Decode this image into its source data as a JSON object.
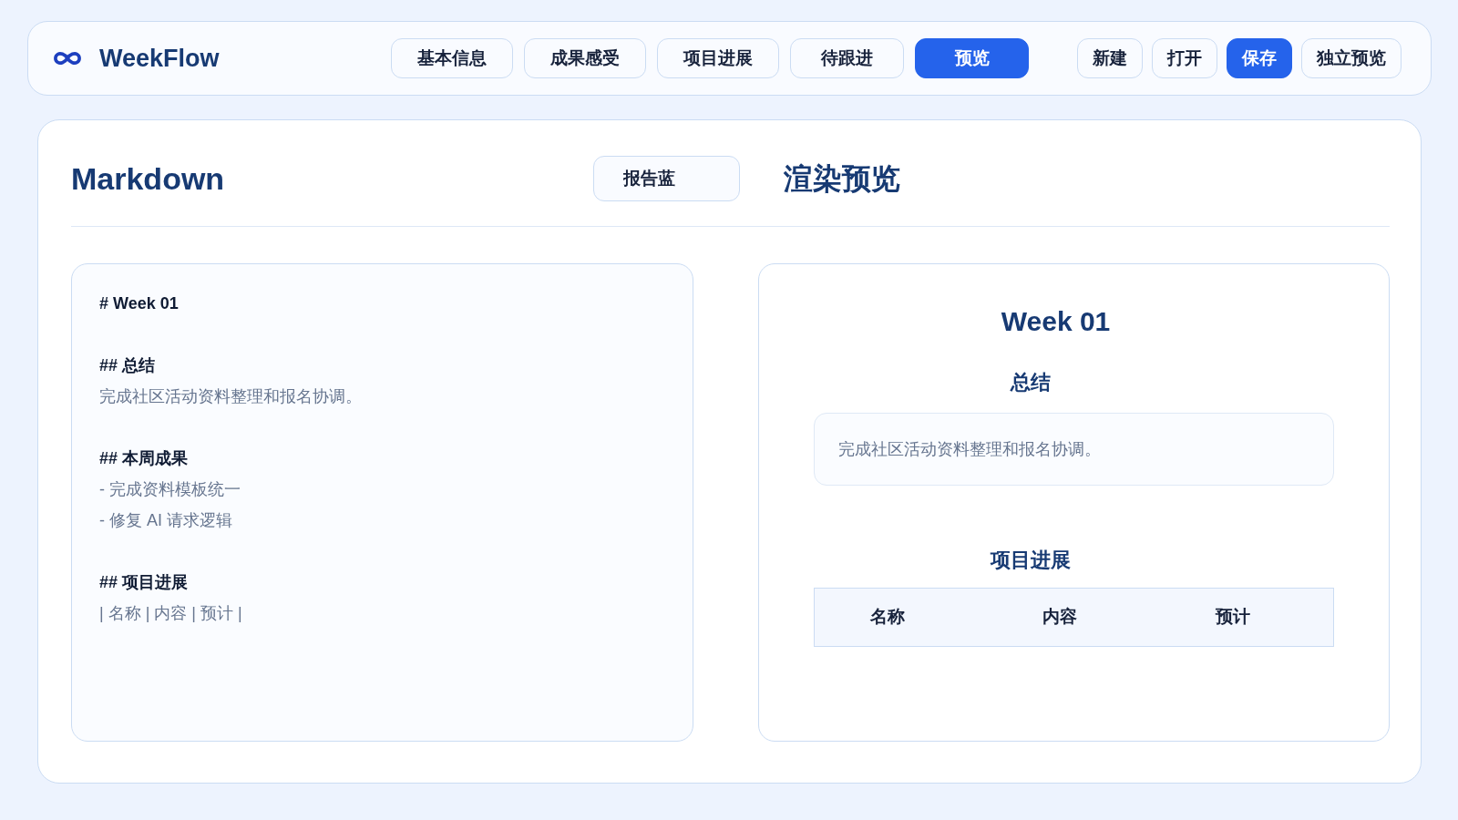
{
  "header": {
    "brand": "WeekFlow",
    "tabs": [
      {
        "label": "基本信息",
        "selected": false
      },
      {
        "label": "成果感受",
        "selected": false
      },
      {
        "label": "项目进展",
        "selected": false
      },
      {
        "label": "待跟进",
        "selected": false
      },
      {
        "label": "预览",
        "selected": true
      }
    ],
    "buttons": [
      {
        "label": "新建",
        "kind": "default"
      },
      {
        "label": "打开",
        "kind": "default"
      },
      {
        "label": "保存",
        "kind": "primary"
      },
      {
        "label": "独立预览",
        "kind": "default"
      }
    ]
  },
  "editor": {
    "title": "Markdown",
    "theme_select": {
      "value": "报告蓝"
    },
    "blocks": [
      {
        "heading": "# Week 01"
      },
      {
        "heading": "## 总结",
        "lines": [
          "完成社区活动资料整理和报名协调。"
        ]
      },
      {
        "heading": "## 本周成果",
        "lines": [
          "- 完成资料模板统一",
          "- 修复 AI 请求逻辑"
        ]
      },
      {
        "heading": "## 项目进展",
        "lines": [
          "| 名称 | 内容 | 预计 |"
        ]
      }
    ]
  },
  "preview": {
    "title": "渲染预览",
    "doc_title": "Week 01",
    "sections": [
      {
        "kind": "summary",
        "heading": "总结",
        "text": "完成社区活动资料整理和报名协调。"
      },
      {
        "kind": "table",
        "heading": "项目进展",
        "columns": [
          "名称",
          "内容",
          "预计"
        ]
      }
    ]
  }
}
